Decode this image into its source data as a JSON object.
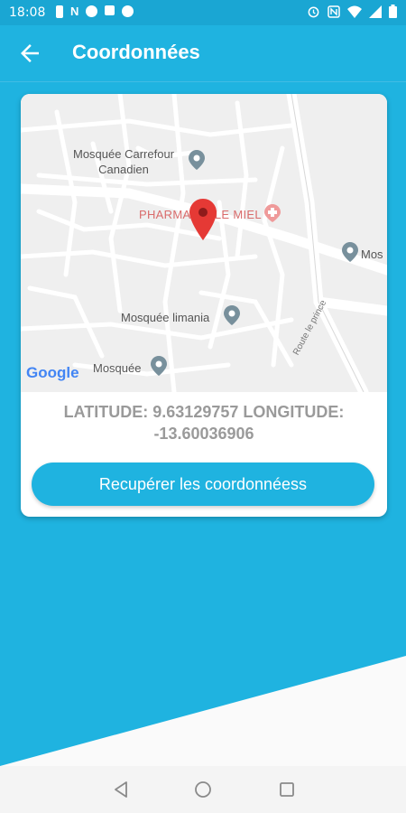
{
  "status_bar": {
    "time": "18:08",
    "icons_left": [
      "battery-saver-icon",
      "notification-n-icon",
      "facebook-icon",
      "cast-icon",
      "facebook-icon"
    ],
    "icons_right": [
      "alarm-icon",
      "nfc-icon",
      "wifi-icon",
      "signal-icon",
      "battery-icon"
    ]
  },
  "app_bar": {
    "title": "Coordonnées",
    "back_icon": "arrow-left-icon"
  },
  "map": {
    "places": [
      {
        "name_line1": "Mosquée Carrefour",
        "name_line2": "Canadien"
      },
      {
        "name_line1": "PHARMACIE LE MIEL"
      },
      {
        "name_line1": "Mos"
      },
      {
        "name_line1": "Mosquée limania"
      },
      {
        "name_line1": "Mosquée"
      }
    ],
    "road_label": "Route le prince",
    "logo": "Google"
  },
  "coordinates": {
    "line1": "LATITUDE: 9.63129757 LONGITUDE:",
    "line2": "-13.60036906"
  },
  "button": {
    "label": "Recupérer les coordonnéess"
  },
  "colors": {
    "primary": "#1fb3e0",
    "status_bar": "#1aa6d3",
    "pin": "#e53935",
    "text_grey": "#9a9a9a"
  }
}
